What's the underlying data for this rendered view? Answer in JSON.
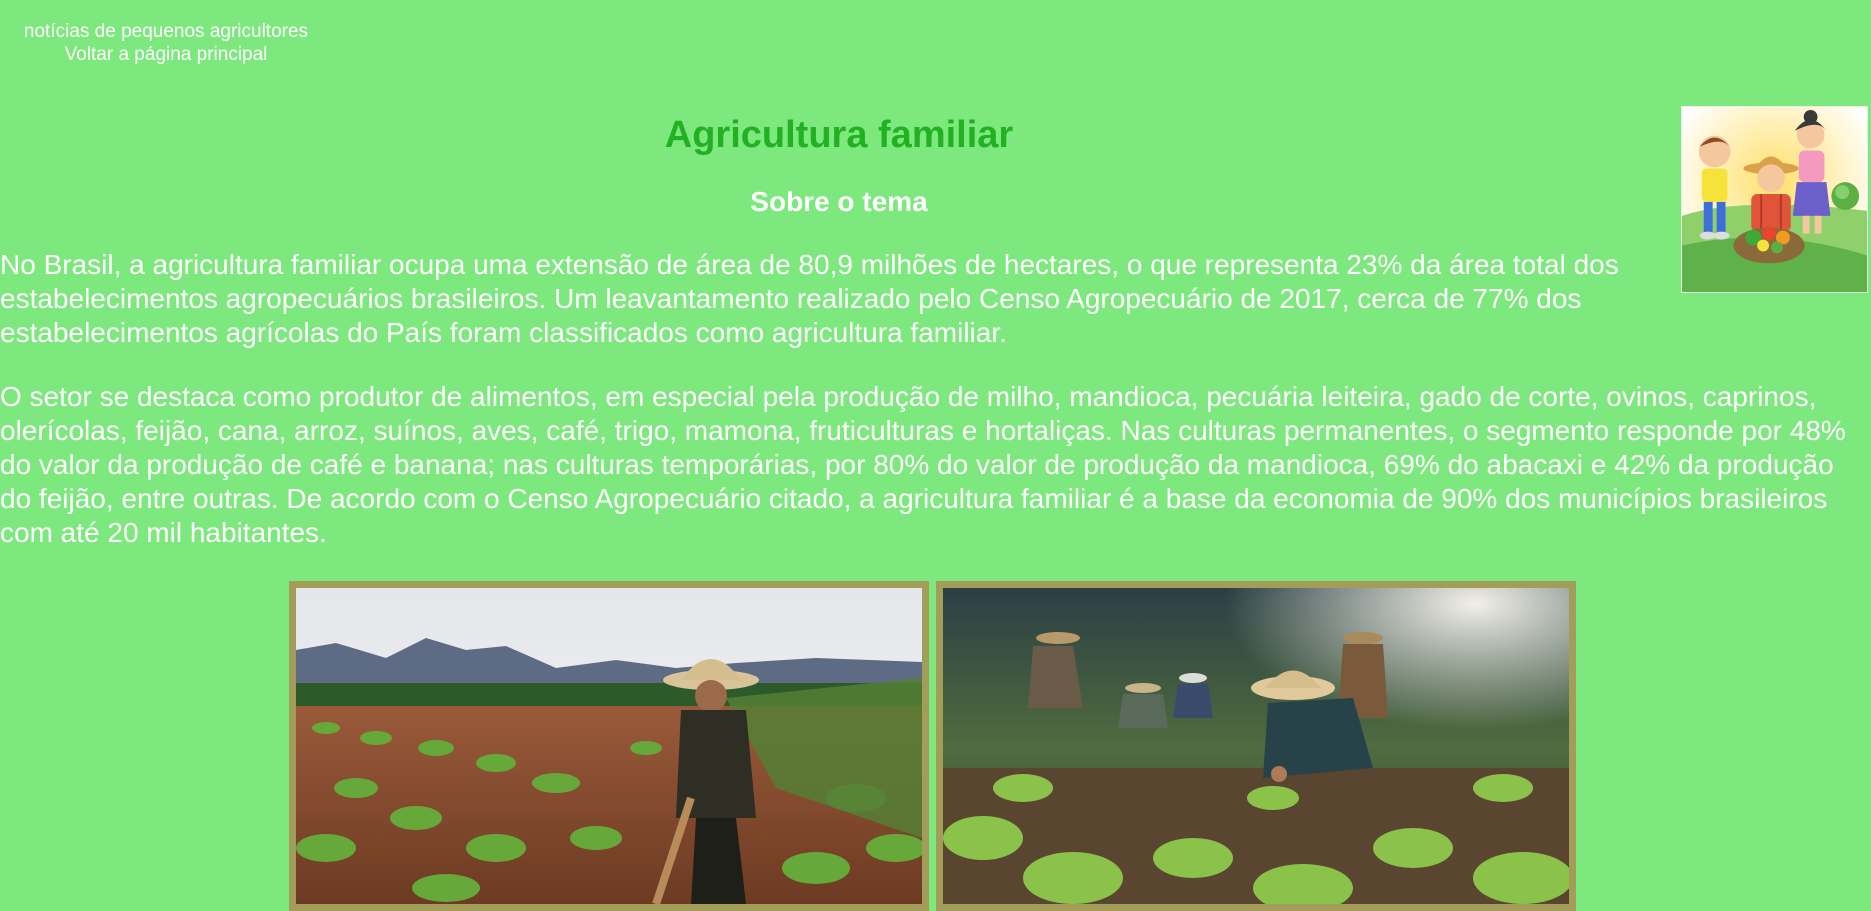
{
  "nav": {
    "site_title": "notícias de pequenos agricultores",
    "home_link": "Voltar a página principal"
  },
  "article": {
    "title": "Agricultura familiar",
    "section_heading": "Sobre o tema",
    "paragraphs": [
      "No Brasil, a agricultura familiar ocupa uma extensão de área de 80,9 milhões de hectares, o que representa 23% da área total dos estabelecimentos agropecuários brasileiros. Um leavantamento realizado pelo Censo Agropecuário de 2017, cerca de 77% dos estabelecimentos agrícolas do País foram classificados como agricultura familiar.",
      "O setor se destaca como produtor de alimentos, em especial pela produção de milho, mandioca, pecuária leiteira, gado de corte, ovinos, caprinos, olerícolas, feijão, cana, arroz, suínos, aves, café, trigo, mamona, fruticulturas e hortaliças. Nas culturas permanentes, o segmento responde por 48% do valor da produção de café e banana; nas culturas temporárias, por 80% do valor de produção da mandioca, 69% do abacaxi e 42% da produção do feijão, entre outras. De acordo com o Censo Agropecuário citado, a agricultura familiar é a base da economia de 90% dos municípios brasileiros com até 20 mil habitantes."
    ]
  },
  "colors": {
    "background": "#7de87d",
    "title": "#22b122",
    "text": "#ffffff",
    "photo_border": "#a39d5a"
  }
}
